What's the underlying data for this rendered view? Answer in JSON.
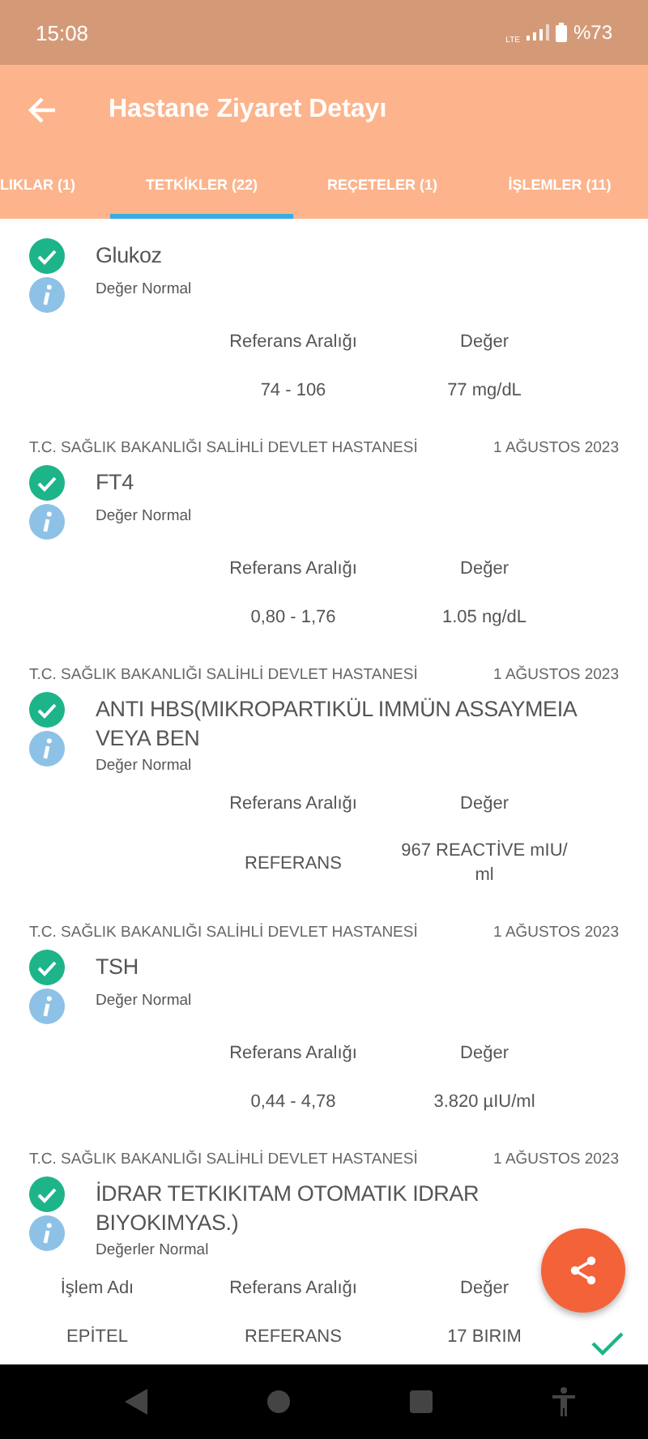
{
  "status_bar": {
    "time": "15:08",
    "network": "LTE",
    "battery": "%73"
  },
  "app_bar": {
    "title": "Hastane Ziyaret Detayı"
  },
  "tabs": [
    {
      "label": "LIKLAR (1)",
      "selected": false
    },
    {
      "label": "TETKİKLER (22)",
      "selected": true
    },
    {
      "label": "REÇETELER (1)",
      "selected": false
    },
    {
      "label": "İŞLEMLER (11)",
      "selected": false
    }
  ],
  "results": [
    {
      "name": "Glukoz",
      "normal": true,
      "note": "Değer Normal",
      "columns": [
        "Referans Aralığı",
        "Değer"
      ],
      "rows": [
        {
          "cells": [
            "74 - 106",
            "77 mg/dL"
          ]
        }
      ]
    },
    {
      "hospital": "T.C. SAĞLIK BAKANLIĞI SALİHLİ DEVLET HASTANESİ",
      "date": "1 AĞUSTOS 2023",
      "name": "FT4",
      "normal": true,
      "note": "Değer Normal",
      "columns": [
        "Referans Aralığı",
        "Değer"
      ],
      "rows": [
        {
          "cells": [
            "0,80 - 1,76",
            "1.05 ng/dL"
          ]
        }
      ]
    },
    {
      "hospital": "T.C. SAĞLIK BAKANLIĞI SALİHLİ DEVLET HASTANESİ",
      "date": "1 AĞUSTOS 2023",
      "name": "ANTI HBS(MIKROPARTIKÜL IMMÜN ASSAYMEIA VEYA BEN",
      "normal": true,
      "note": "Değer Normal",
      "columns": [
        "Referans Aralığı",
        "Değer"
      ],
      "rows": [
        {
          "cells": [
            "REFERANS",
            "967 REACTİVE mIU/ ml"
          ]
        }
      ]
    },
    {
      "hospital": "T.C. SAĞLIK BAKANLIĞI SALİHLİ DEVLET HASTANESİ",
      "date": "1 AĞUSTOS 2023",
      "name": "TSH",
      "normal": true,
      "note": "Değer Normal",
      "columns": [
        "Referans Aralığı",
        "Değer"
      ],
      "rows": [
        {
          "cells": [
            "0,44 - 4,78",
            "3.820 µIU/ml"
          ]
        }
      ]
    },
    {
      "hospital": "T.C. SAĞLIK BAKANLIĞI SALİHLİ DEVLET HASTANESİ",
      "date": "1 AĞUSTOS 2023",
      "name": "İDRAR TETKIKITAM OTOMATIK IDRAR BIYOKIMYAS.)",
      "normal": true,
      "note": "Değerler Normal",
      "columns": [
        "İşlem Adı",
        "Referans Aralığı",
        "Değer"
      ],
      "rows": [
        {
          "cells": [
            "EPİTEL",
            "REFERANS",
            "17 BIRIM"
          ],
          "normal": true
        }
      ]
    }
  ]
}
